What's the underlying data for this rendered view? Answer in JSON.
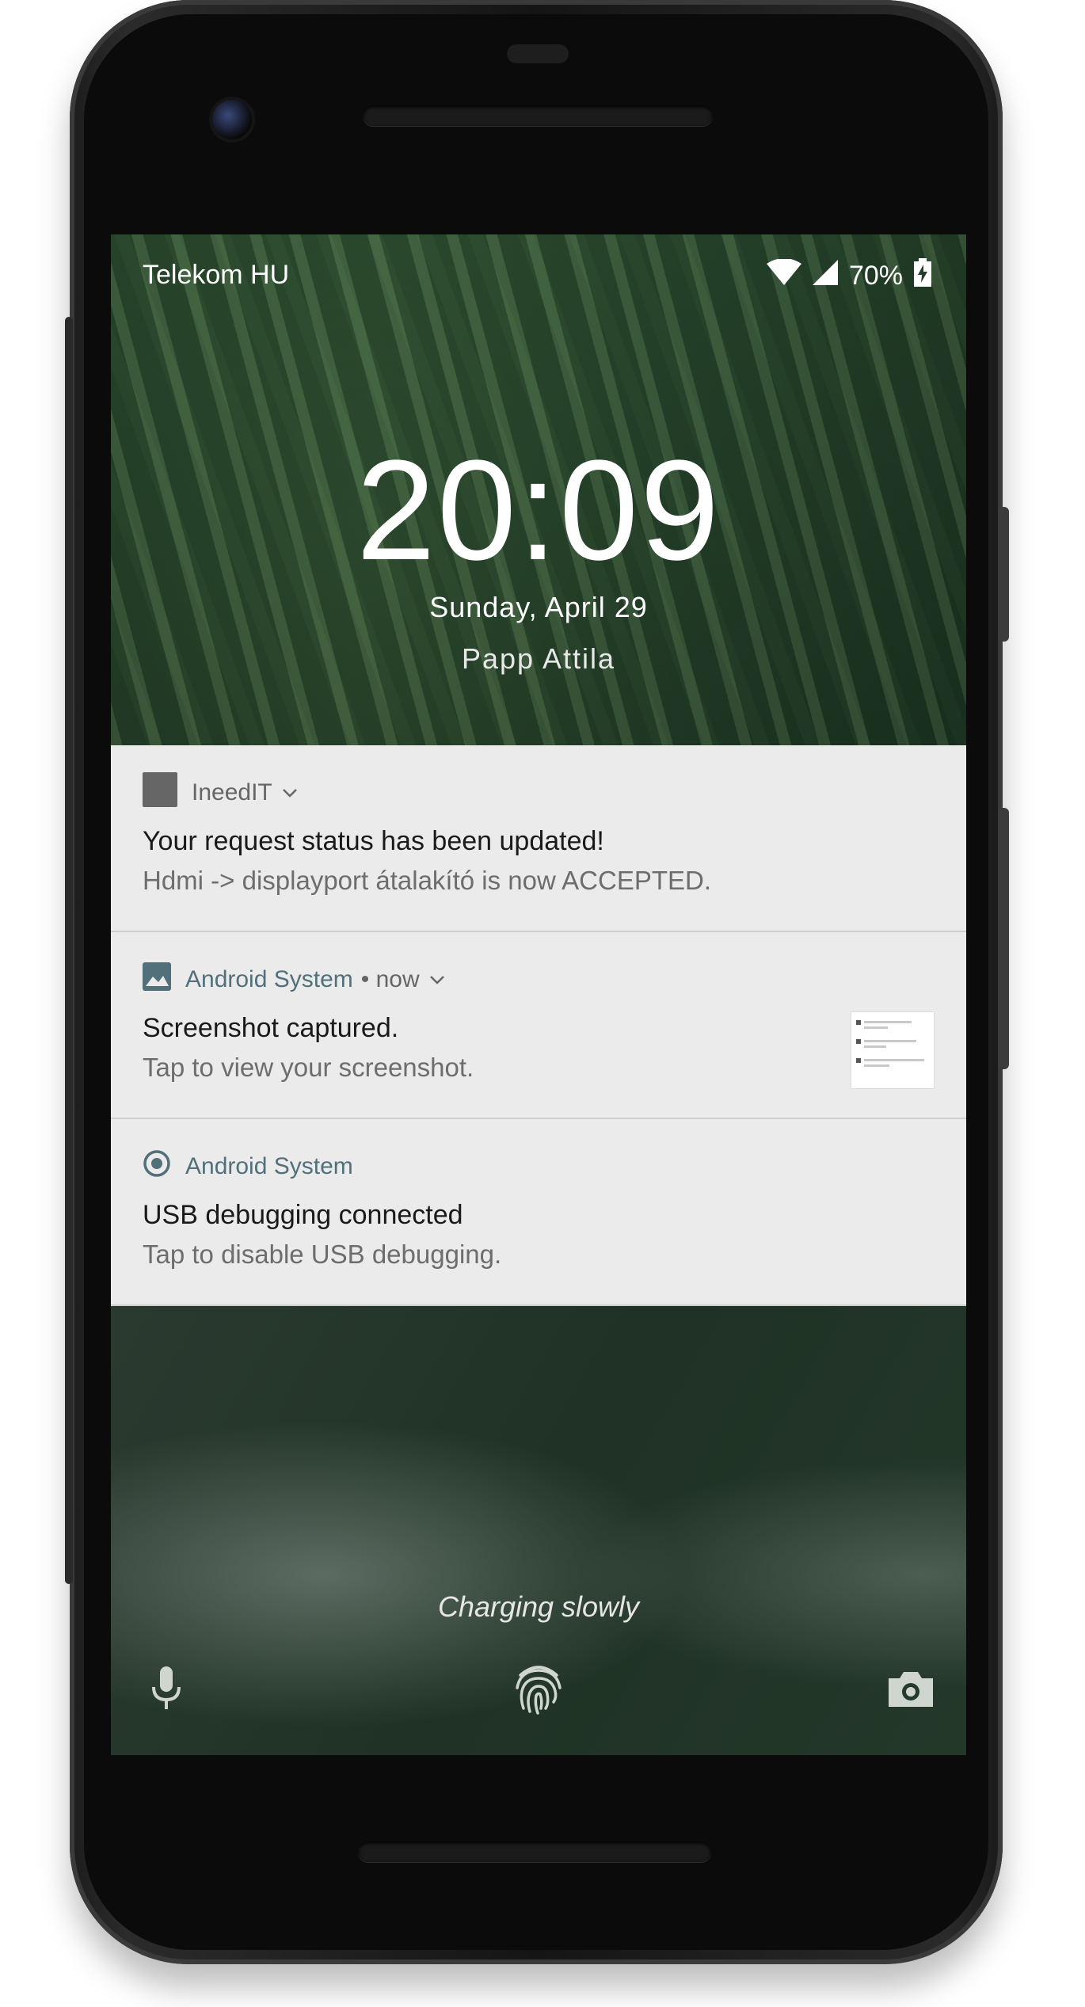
{
  "status_bar": {
    "carrier": "Telekom HU",
    "battery_percent": "70%",
    "icons": [
      "wifi-icon",
      "cell-signal-icon",
      "battery-charging-icon"
    ]
  },
  "lockscreen": {
    "time": "20:09",
    "date": "Sunday, April 29",
    "owner_info": "Papp Attila",
    "charging_text": "Charging slowly"
  },
  "notifications": [
    {
      "app_name": "IneedIT",
      "meta": "",
      "title": "Your request status has been updated!",
      "body": "Hdmi -> displayport átalakító is now ACCEPTED.",
      "icon": "app-square-icon"
    },
    {
      "app_name": "Android System",
      "meta": "• now",
      "title": "Screenshot captured.",
      "body": "Tap to view your screenshot.",
      "icon": "image-icon"
    },
    {
      "app_name": "Android System",
      "meta": "",
      "title": "USB debugging connected",
      "body": "Tap to disable USB debugging.",
      "icon": "radio-target-icon"
    }
  ],
  "bottom_actions": [
    "microphone-icon",
    "fingerprint-icon",
    "camera-icon"
  ],
  "colors": {
    "notification_bg": "#ebebeb",
    "system_app_accent": "#52707a"
  }
}
